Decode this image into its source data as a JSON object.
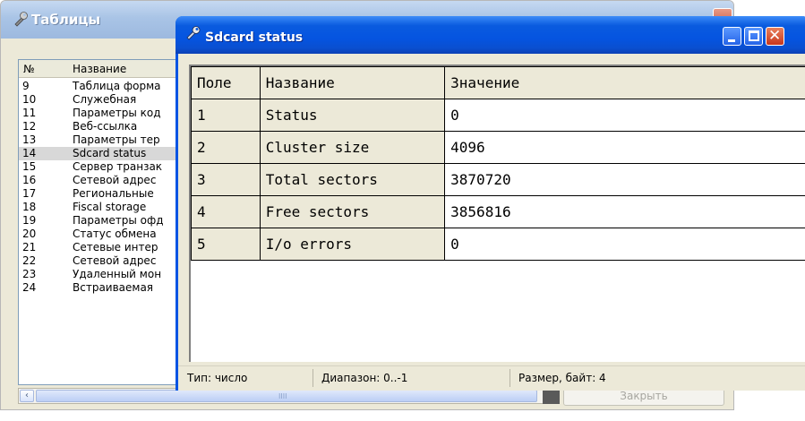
{
  "tables_window": {
    "title": "Таблицы",
    "list_headers": {
      "num": "№",
      "name": "Название"
    },
    "rows": [
      {
        "num": "9",
        "name": "Таблица форма"
      },
      {
        "num": "10",
        "name": "Служебная"
      },
      {
        "num": "11",
        "name": "Параметры код"
      },
      {
        "num": "12",
        "name": "Веб-ссылка"
      },
      {
        "num": "13",
        "name": "Параметры тер"
      },
      {
        "num": "14",
        "name": "Sdcard status"
      },
      {
        "num": "15",
        "name": "Сервер транзак"
      },
      {
        "num": "16",
        "name": "Сетевой адрес"
      },
      {
        "num": "17",
        "name": "Региональные"
      },
      {
        "num": "18",
        "name": "Fiscal storage"
      },
      {
        "num": "19",
        "name": "Параметры офд"
      },
      {
        "num": "20",
        "name": "Статус обмена"
      },
      {
        "num": "21",
        "name": "Сетевые интер"
      },
      {
        "num": "22",
        "name": "Сетевой адрес"
      },
      {
        "num": "23",
        "name": "Удаленный мон"
      },
      {
        "num": "24",
        "name": "Встраиваемая"
      }
    ],
    "selected_row_num": "14",
    "close_button_label": "Закрыть",
    "scroll_left_glyph": "‹",
    "scroll_right_glyph": "›",
    "scroll_grip_glyph": "IIII"
  },
  "sdcard_window": {
    "title": "Sdcard status",
    "buttons": {
      "close_glyph": "✕"
    },
    "grid": {
      "headers": [
        "Поле",
        "Название",
        "Значение"
      ],
      "rows": [
        [
          "1",
          "Status",
          "0"
        ],
        [
          "2",
          "Cluster size",
          "4096"
        ],
        [
          "3",
          "Total sectors",
          "3870720"
        ],
        [
          "4",
          "Free sectors",
          "3856816"
        ],
        [
          "5",
          "I/o errors",
          "0"
        ]
      ]
    },
    "status_bar": {
      "type": "Тип: число",
      "range": "Диапазон: 0..-1",
      "size": "Размер, байт: 4"
    }
  },
  "colors": {
    "titlebar_active": "#0554e0",
    "titlebar_inactive": "#a9c4e6",
    "window_face": "#ece9d8",
    "close_red": "#c8361b"
  }
}
